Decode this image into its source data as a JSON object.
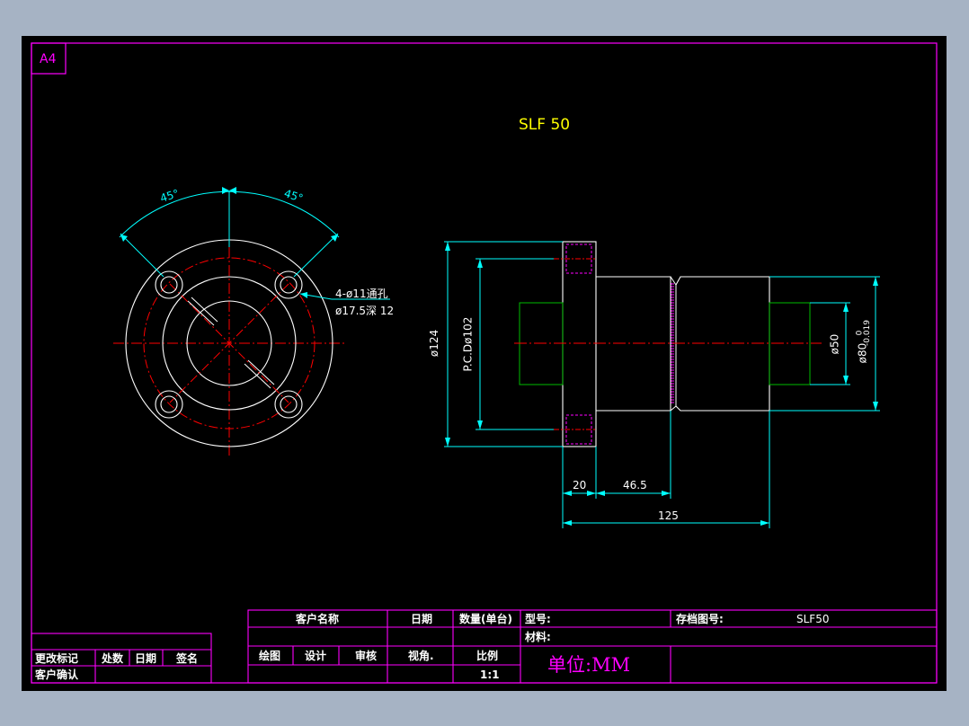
{
  "sheet": {
    "size_label": "A4",
    "title": "SLF 50"
  },
  "annotations": {
    "angle_left": "45°",
    "angle_right": "45°",
    "hole_spec_1": "4-ø11通孔",
    "hole_spec_2": "ø17.5深 12"
  },
  "dimensions": {
    "d124": "ø124",
    "pcd": "P.C.Dø102",
    "d50": "ø50",
    "d80": "ø80",
    "d80_tol_upper": "0",
    "d80_tol_lower": "-0.019",
    "len20": "20",
    "len46": "46.5",
    "len125": "125"
  },
  "title_block": {
    "customer_name": "客户名称",
    "date": "日期",
    "qty": "数量(单台)",
    "model": "型号:",
    "archive_no": "存档图号:",
    "archive_value": "SLF50",
    "material": "材料:",
    "drawn": "绘图",
    "design": "设计",
    "review": "审核",
    "view_angle": "视角.",
    "scale": "比例",
    "scale_value": "1:1",
    "unit": "单位:MM",
    "rev_mark": "更改标记",
    "rev_count": "处数",
    "rev_date": "日期",
    "sign": "签名",
    "customer_confirm": "客户确认"
  },
  "colors": {
    "background": "#000000",
    "frame": "#ff00ff",
    "outline": "#ffffff",
    "centerline": "#ff0000",
    "dimension": "#00ffff",
    "hidden": "#00aa00",
    "title": "#ffff00"
  }
}
